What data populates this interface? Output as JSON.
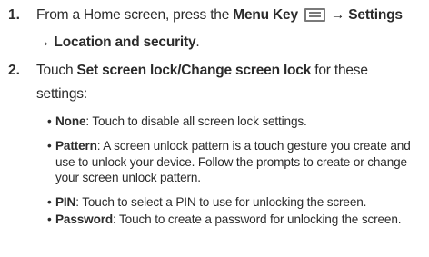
{
  "steps": [
    {
      "number": "1.",
      "menu_icon": "menu-key-icon",
      "lines": [
        {
          "pre": "From a Home screen, press the ",
          "bold": "Menu Key",
          "post": "",
          "tail_arrow": "→",
          "tail_bold": "Settings"
        },
        {
          "arrow": "→",
          "bold": "Location and security",
          "post": "."
        }
      ]
    },
    {
      "number": "2.",
      "line1_pre": "Touch ",
      "line1_bold": "Set screen lock/Change screen lock",
      "line1_post": " for these",
      "line2": "settings:"
    }
  ],
  "bullets": [
    {
      "term": "None",
      "lines": [
        ": Touch to disable all screen lock settings."
      ]
    },
    {
      "term": "Pattern",
      "lines": [
        ": A screen unlock pattern is a touch gesture you create and",
        "use to unlock your device. Follow the prompts to create or change",
        "your screen unlock pattern."
      ]
    },
    {
      "term": "PIN",
      "lines": [
        ": Touch to select a PIN to use for unlocking the screen."
      ]
    },
    {
      "term": "Password",
      "lines": [
        ": Touch to create a password for unlocking the screen."
      ]
    }
  ],
  "bullet_char": "•"
}
